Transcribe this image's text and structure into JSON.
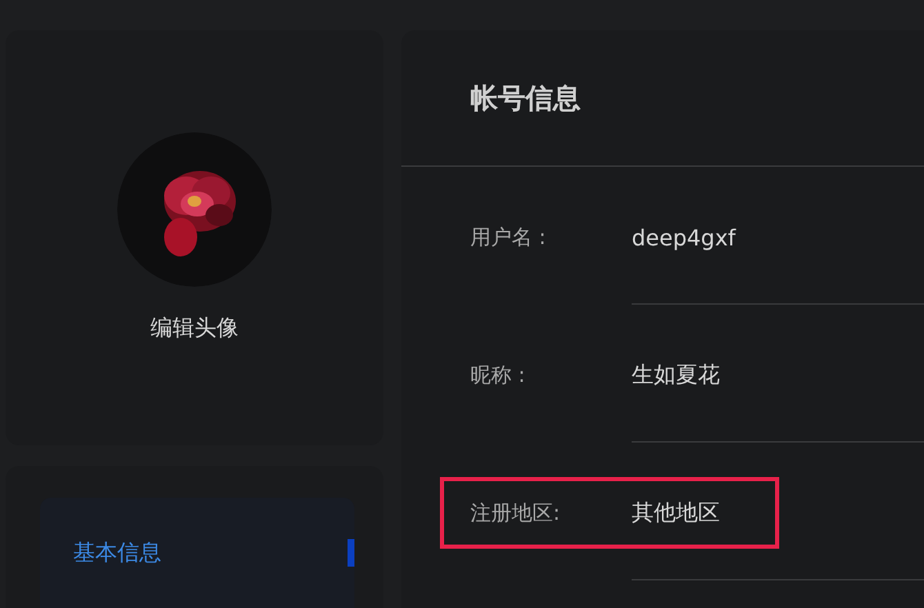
{
  "profile": {
    "edit_label": "编辑头像"
  },
  "menu": [
    {
      "label": "基本信息",
      "selected": true
    }
  ],
  "account": {
    "title": "帐号信息",
    "fields": [
      {
        "label": "用户名 :",
        "value": "deep4gxf",
        "highlighted": false
      },
      {
        "label": "昵称 :",
        "value": "生如夏花",
        "highlighted": false
      },
      {
        "label": "注册地区:",
        "value": "其他地区",
        "highlighted": true
      }
    ]
  }
}
